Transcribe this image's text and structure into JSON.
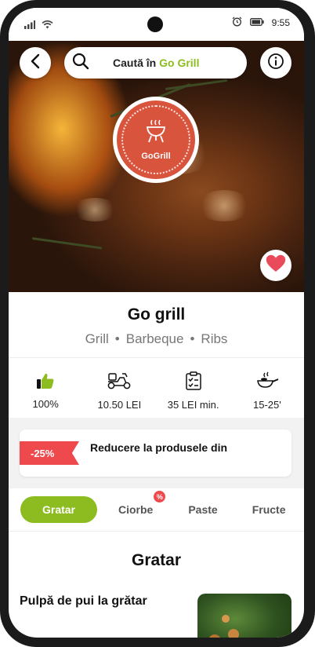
{
  "status_bar": {
    "time": "9:55"
  },
  "search": {
    "prefix": "Caută în",
    "brand": "Go Grill"
  },
  "logo": {
    "text": "GoGrill"
  },
  "restaurant": {
    "name": "Go grill",
    "tags": [
      "Grill",
      "Barbeque",
      "Ribs"
    ],
    "separator": "•"
  },
  "stats": [
    {
      "icon": "thumbs-up-icon",
      "value": "100%"
    },
    {
      "icon": "delivery-scooter-icon",
      "value": "10.50 LEI"
    },
    {
      "icon": "checklist-icon",
      "value": "35 LEI min."
    },
    {
      "icon": "cooking-pan-icon",
      "value": "15-25'"
    }
  ],
  "promo": {
    "badge": "-25%",
    "text": "Reducere la produsele din"
  },
  "tabs": [
    {
      "label": "Gratar",
      "active": true
    },
    {
      "label": "Ciorbe",
      "badge": "%"
    },
    {
      "label": "Paste"
    },
    {
      "label": "Fructe"
    }
  ],
  "section": {
    "title": "Gratar"
  },
  "product": {
    "name": "Pulpă de pui la grătar"
  },
  "colors": {
    "brand_green": "#8cbc1f",
    "logo_red": "#d9543c",
    "promo_red": "#ee4a4e",
    "heart_red": "#e94b5a"
  }
}
